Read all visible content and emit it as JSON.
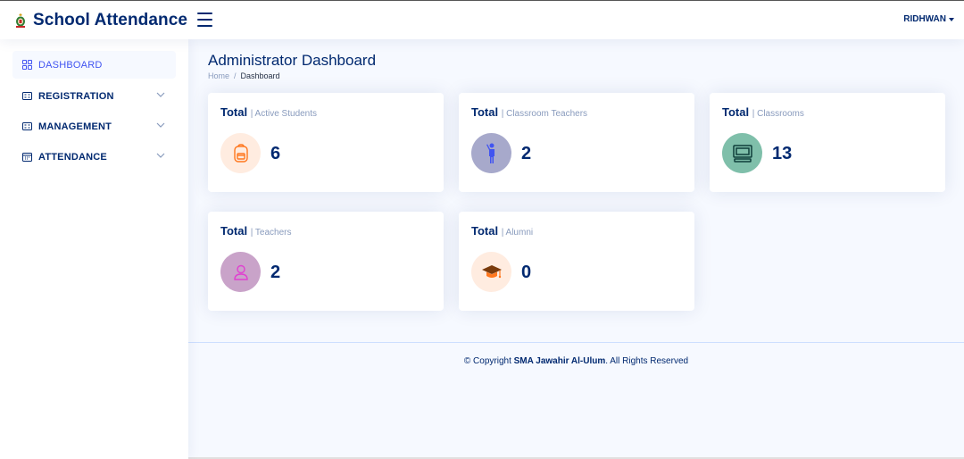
{
  "header": {
    "app_title": "School Attendance",
    "user_name": "RIDHWAN",
    "logo_icon": "school-crest-icon",
    "menu_icon": "hamburger-icon"
  },
  "sidebar": {
    "items": [
      {
        "label": "DASHBOARD",
        "icon": "grid-icon",
        "active": true
      },
      {
        "label": "REGISTRATION",
        "icon": "card-icon",
        "expandable": true
      },
      {
        "label": "MANAGEMENT",
        "icon": "card-icon",
        "expandable": true
      },
      {
        "label": "ATTENDANCE",
        "icon": "calendar-icon",
        "expandable": true
      }
    ]
  },
  "main": {
    "page_title": "Administrator Dashboard",
    "breadcrumb": {
      "home": "Home",
      "separator": "/",
      "current": "Dashboard"
    },
    "cards": [
      {
        "title": "Total",
        "subtitle": "| Active Students",
        "value": "6",
        "icon": "backpack-icon",
        "icon_bg": "#ffece0",
        "icon_color": "#ff771d"
      },
      {
        "title": "Total",
        "subtitle": "| Classroom Teachers",
        "value": "2",
        "icon": "teacher-presenting-icon",
        "icon_bg": "#a7a9cb",
        "icon_color": "#4154f1"
      },
      {
        "title": "Total",
        "subtitle": "| Classrooms",
        "value": "13",
        "icon": "monitor-icon",
        "icon_bg": "#7fbfaa",
        "icon_color": "#0e6e63"
      },
      {
        "title": "Total",
        "subtitle": "| Teachers",
        "value": "2",
        "icon": "person-icon",
        "icon_bg": "#c9a3c9",
        "icon_color": "#e040d0"
      },
      {
        "title": "Total",
        "subtitle": "| Alumni",
        "value": "0",
        "icon": "graduation-cap-icon",
        "icon_bg": "#ffece0",
        "icon_color": "#ff771d"
      }
    ]
  },
  "footer": {
    "prefix": "© Copyright",
    "org": "SMA Jawahir Al-Ulum",
    "suffix": ". All Rights Reserved"
  },
  "colors": {
    "primary": "#012970",
    "accent": "#4154f1",
    "muted": "#899bbd",
    "background": "#f6f9ff"
  }
}
